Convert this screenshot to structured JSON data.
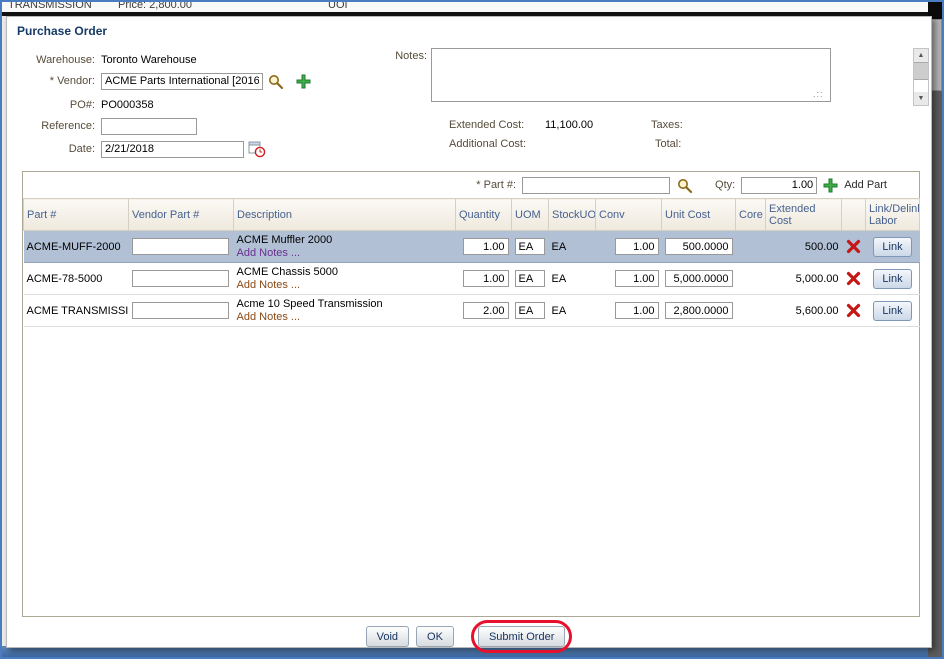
{
  "background": {
    "left_text": "TRANSMISSION",
    "price_text": "Price:   2,800.00",
    "uom_text": "UOI"
  },
  "icons": {
    "scroll_up": "▲",
    "scroll_down": "▼",
    "resize_grip": ".::"
  },
  "colors": {
    "annotation_red": "#e8112d",
    "selected_row": "#b2c0d6",
    "header_text": "#46618e"
  },
  "dialog": {
    "title": "Purchase Order",
    "form": {
      "warehouse_label": "Warehouse:",
      "warehouse_value": "Toronto Warehouse",
      "vendor_label": "* Vendor:",
      "vendor_value": "ACME Parts International [2016",
      "po_label": "PO#:",
      "po_value": "PO000358",
      "reference_label": "Reference:",
      "reference_value": "",
      "date_label": "Date:",
      "date_value": "2/21/2018",
      "notes_label": "Notes:"
    },
    "summary": {
      "extended_cost_label": "Extended Cost:",
      "extended_cost_value": "11,100.00",
      "taxes_label": "Taxes:",
      "taxes_value": "",
      "additional_cost_label": "Additional Cost:",
      "additional_cost_value": "",
      "total_label": "Total:",
      "total_value": ""
    },
    "part_entry": {
      "part_label": "* Part #:",
      "part_value": "",
      "qty_label": "Qty:",
      "qty_value": "1.00",
      "add_part_label": "Add Part"
    },
    "table": {
      "headers": [
        "Part #",
        "Vendor Part #",
        "Description",
        "Quantity",
        "UOM",
        "StockUOM",
        "Conv",
        "Unit Cost",
        "Core",
        "Extended Cost",
        "",
        "Link/Delink Labor"
      ],
      "rows": [
        {
          "part": "ACME-MUFF-2000",
          "vendor_part": "",
          "description": "ACME Muffler 2000",
          "add_notes": "Add Notes ...",
          "qty": "1.00",
          "uom": "EA",
          "stock_uom": "EA",
          "conv": "1.00",
          "unit_cost": "500.0000",
          "core": "",
          "extended_cost": "500.00",
          "link_label": "Link",
          "selected": true
        },
        {
          "part": "ACME-78-5000",
          "vendor_part": "",
          "description": "ACME Chassis 5000",
          "add_notes": "Add Notes ...",
          "qty": "1.00",
          "uom": "EA",
          "stock_uom": "EA",
          "conv": "1.00",
          "unit_cost": "5,000.0000",
          "core": "",
          "extended_cost": "5,000.00",
          "link_label": "Link",
          "selected": false
        },
        {
          "part": "ACME TRANSMISSION",
          "vendor_part": "",
          "description": "Acme 10 Speed Transmission",
          "add_notes": "Add Notes ...",
          "qty": "2.00",
          "uom": "EA",
          "stock_uom": "EA",
          "conv": "1.00",
          "unit_cost": "2,800.0000",
          "core": "",
          "extended_cost": "5,600.00",
          "link_label": "Link",
          "selected": false
        }
      ]
    },
    "footer": {
      "void_label": "Void",
      "ok_label": "OK",
      "submit_label": "Submit Order"
    }
  }
}
